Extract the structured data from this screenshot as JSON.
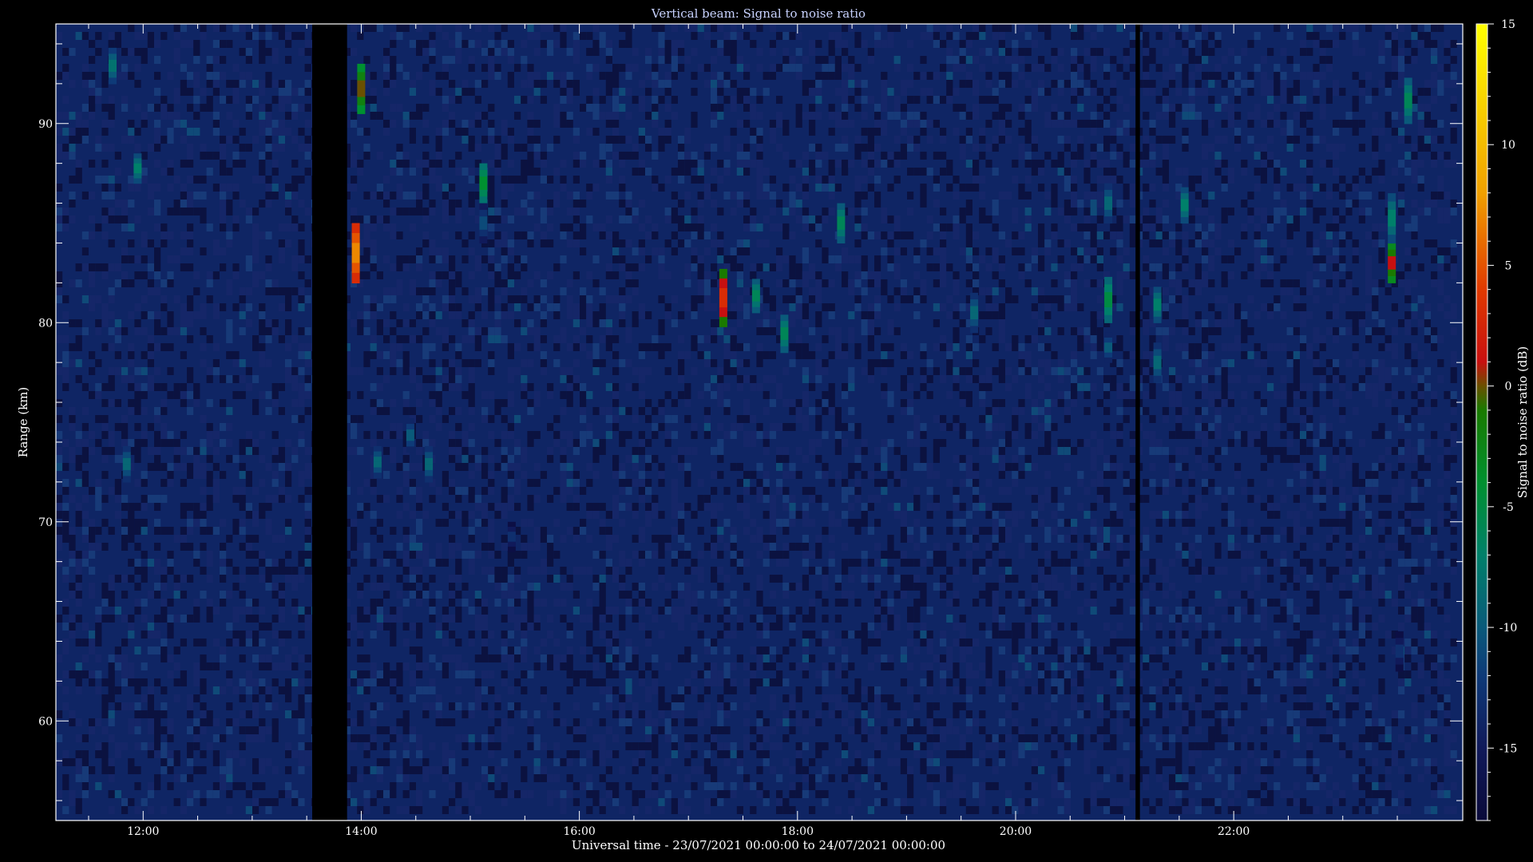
{
  "chart_data": {
    "type": "heatmap",
    "title": "Vertical beam: Signal to noise ratio",
    "xlabel": "Universal time - 23/07/2021 00:00:00 to 24/07/2021 00:00:00",
    "ylabel": "Range (km)",
    "colorbar_label": "Signal to noise ratio (dB)",
    "x_unit": "hours UT",
    "xlim": [
      11.2,
      24.1
    ],
    "ylim": [
      55.0,
      95.0
    ],
    "x_ticks": [
      {
        "value": 12,
        "label": "12:00"
      },
      {
        "value": 14,
        "label": "14:00"
      },
      {
        "value": 16,
        "label": "16:00"
      },
      {
        "value": 18,
        "label": "18:00"
      },
      {
        "value": 20,
        "label": "20:00"
      },
      {
        "value": 22,
        "label": "22:00"
      }
    ],
    "y_ticks": [
      {
        "value": 60,
        "label": "60"
      },
      {
        "value": 70,
        "label": "70"
      },
      {
        "value": 80,
        "label": "80"
      },
      {
        "value": 90,
        "label": "90"
      }
    ],
    "colorbar_range": [
      -18,
      15
    ],
    "colorbar_ticks": [
      {
        "value": 15,
        "label": "15"
      },
      {
        "value": 10,
        "label": "10"
      },
      {
        "value": 5,
        "label": "5"
      },
      {
        "value": 0,
        "label": "0"
      },
      {
        "value": -5,
        "label": "-5"
      },
      {
        "value": -10,
        "label": "-10"
      },
      {
        "value": -15,
        "label": "-15"
      }
    ],
    "colormap": [
      {
        "value": -18,
        "color": "#0a0a3a"
      },
      {
        "value": -15,
        "color": "#101a5a"
      },
      {
        "value": -12,
        "color": "#0e3a78"
      },
      {
        "value": -10,
        "color": "#0a5a7a"
      },
      {
        "value": -7,
        "color": "#00806a"
      },
      {
        "value": -4,
        "color": "#009030"
      },
      {
        "value": -1,
        "color": "#1a7a00"
      },
      {
        "value": 0,
        "color": "#6a5000"
      },
      {
        "value": 1,
        "color": "#c81010"
      },
      {
        "value": 4,
        "color": "#e03a00"
      },
      {
        "value": 8,
        "color": "#f0a000"
      },
      {
        "value": 15,
        "color": "#ffff00"
      }
    ],
    "background_snr": -14,
    "no_data_intervals": [
      [
        13.55,
        13.87
      ],
      [
        21.1,
        21.14
      ]
    ],
    "echoes": [
      {
        "t": 11.72,
        "r0": 92.0,
        "r1": 93.8,
        "snr": -7
      },
      {
        "t": 11.85,
        "r0": 72.0,
        "r1": 73.8,
        "snr": -8
      },
      {
        "t": 11.95,
        "r0": 87.0,
        "r1": 88.5,
        "snr": -6
      },
      {
        "t": 13.95,
        "r0": 82.0,
        "r1": 85.0,
        "snr": 8
      },
      {
        "t": 14.0,
        "r0": 90.5,
        "r1": 93.0,
        "snr": 1
      },
      {
        "t": 14.15,
        "r0": 72.2,
        "r1": 73.8,
        "snr": -8
      },
      {
        "t": 14.45,
        "r0": 73.5,
        "r1": 75.2,
        "snr": -9
      },
      {
        "t": 14.62,
        "r0": 72.0,
        "r1": 73.8,
        "snr": -8
      },
      {
        "t": 15.12,
        "r0": 86.0,
        "r1": 88.0,
        "snr": -3
      },
      {
        "t": 15.12,
        "r0": 84.0,
        "r1": 86.0,
        "snr": -10
      },
      {
        "t": 15.38,
        "r0": 68.5,
        "r1": 70.0,
        "snr": -12
      },
      {
        "t": 17.32,
        "r0": 79.8,
        "r1": 82.7,
        "snr": 4
      },
      {
        "t": 17.62,
        "r0": 80.5,
        "r1": 82.2,
        "snr": -5
      },
      {
        "t": 17.88,
        "r0": 78.5,
        "r1": 80.4,
        "snr": -5
      },
      {
        "t": 18.4,
        "r0": 84.0,
        "r1": 86.0,
        "snr": -5
      },
      {
        "t": 19.62,
        "r0": 79.5,
        "r1": 81.5,
        "snr": -8
      },
      {
        "t": 20.85,
        "r0": 85.0,
        "r1": 87.0,
        "snr": -8
      },
      {
        "t": 20.85,
        "r0": 80.0,
        "r1": 82.3,
        "snr": -4
      },
      {
        "t": 20.85,
        "r0": 78.0,
        "r1": 79.5,
        "snr": -9
      },
      {
        "t": 21.3,
        "r0": 80.0,
        "r1": 81.8,
        "snr": -6
      },
      {
        "t": 21.3,
        "r0": 77.0,
        "r1": 79.0,
        "snr": -8
      },
      {
        "t": 21.55,
        "r0": 85.0,
        "r1": 86.8,
        "snr": -6
      },
      {
        "t": 23.45,
        "r0": 82.0,
        "r1": 84.0,
        "snr": 2
      },
      {
        "t": 23.45,
        "r0": 84.0,
        "r1": 86.5,
        "snr": -6
      },
      {
        "t": 23.6,
        "r0": 90.0,
        "r1": 92.3,
        "snr": -5
      },
      {
        "t": 23.52,
        "r0": 62.5,
        "r1": 64.5,
        "snr": -12
      }
    ]
  }
}
